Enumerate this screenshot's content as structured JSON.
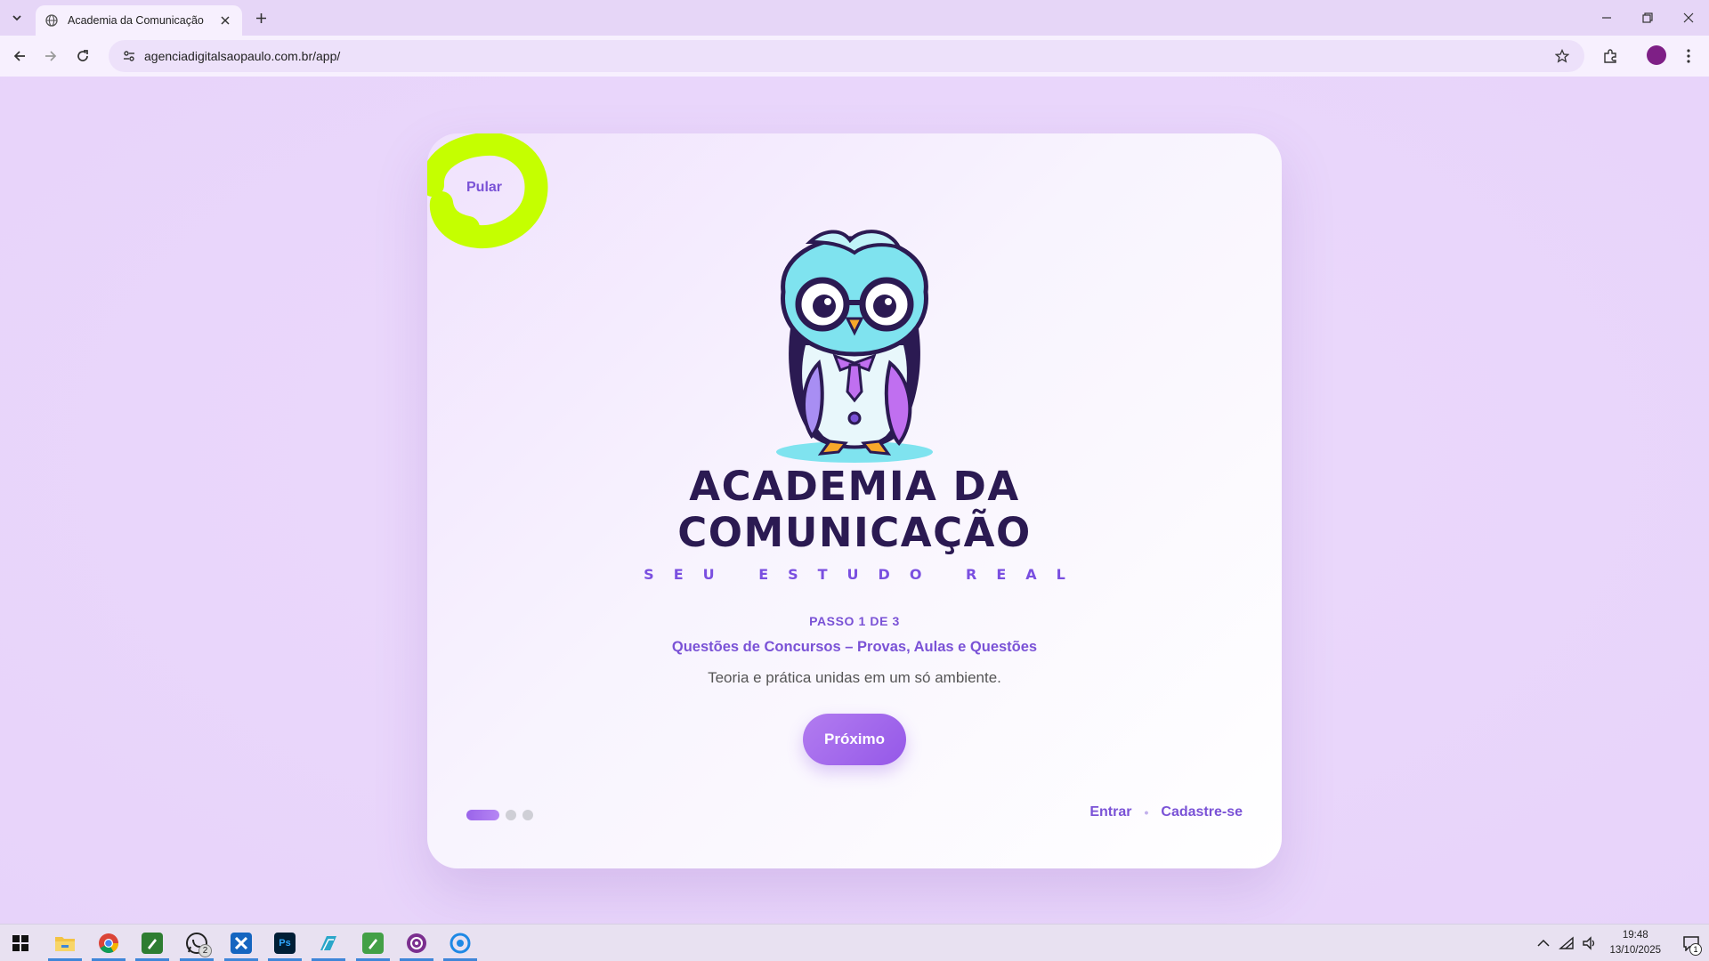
{
  "browser": {
    "tab_title": "Academia da Comunicação",
    "url": "agenciadigitalsaopaulo.com.br/app/"
  },
  "onboarding": {
    "skip_label": "Pular",
    "brand_line1": "ACADEMIA DA",
    "brand_line2": "COMUNICAÇÃO",
    "tagline": "SEU ESTUDO REAL",
    "step_label": "PASSO 1 DE 3",
    "step_title": "Questões de Concursos – Provas, Aulas e Questões",
    "step_description": "Teoria e prática unidas em um só ambiente.",
    "next_label": "Próximo",
    "current_step": 1,
    "total_steps": 3,
    "login_label": "Entrar",
    "separator": "•",
    "signup_label": "Cadastre-se"
  },
  "colors": {
    "accent": "#7a52d6",
    "page_background": "#eddcfb",
    "highlight": "#c5ff00",
    "brand_text": "#2b1a52"
  },
  "taskbar": {
    "apps": [
      {
        "name": "file-explorer-icon"
      },
      {
        "name": "chrome-icon"
      },
      {
        "name": "notepad-icon"
      },
      {
        "name": "whatsapp-icon",
        "badge": "2"
      },
      {
        "name": "app-x-icon"
      },
      {
        "name": "photoshop-icon",
        "label": "Ps"
      },
      {
        "name": "app-blue-icon"
      },
      {
        "name": "notepadpp-icon"
      },
      {
        "name": "app-purple-icon"
      },
      {
        "name": "browser-icon"
      }
    ],
    "time": "19:48",
    "date": "13/10/2025",
    "notification_count": "1"
  }
}
